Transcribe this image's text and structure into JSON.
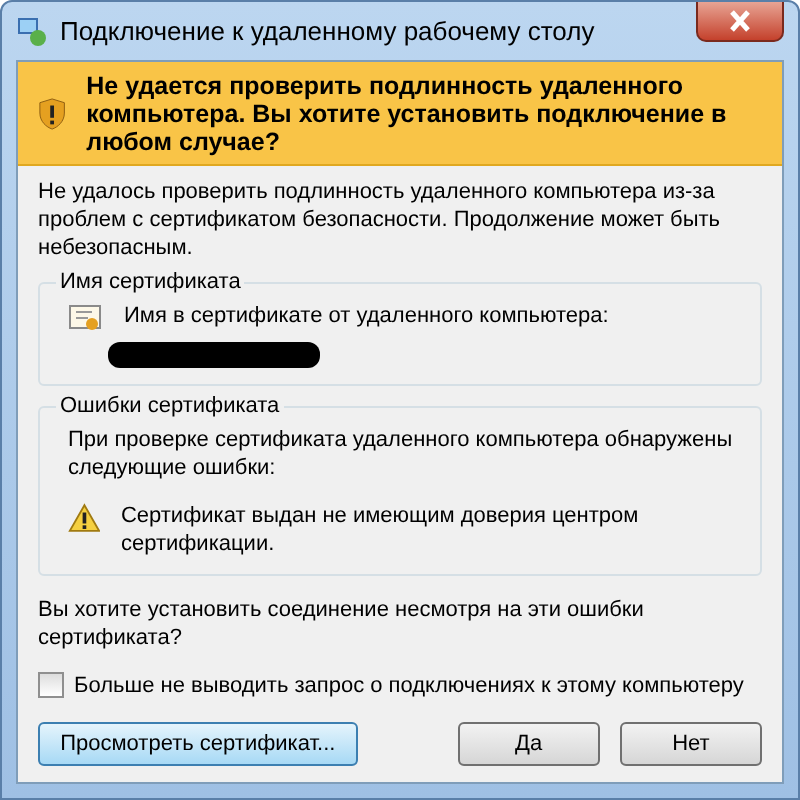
{
  "window": {
    "title": "Подключение к удаленному рабочему столу"
  },
  "banner": {
    "text": "Не удается проверить подлинность удаленного компьютера. Вы хотите установить подключение в любом случае?"
  },
  "description": "Не удалось проверить подлинность удаленного компьютера из-за проблем с сертификатом безопасности. Продолжение может быть небезопасным.",
  "certificate_name": {
    "title": "Имя сертификата",
    "label": "Имя в сертификате от удаленного компьютера:"
  },
  "certificate_errors": {
    "title": "Ошибки сертификата",
    "text": "При проверке сертификата удаленного компьютера обнаружены следующие ошибки:",
    "errors": [
      "Сертификат выдан не имеющим доверия центром сертификации."
    ]
  },
  "question": "Вы хотите установить соединение несмотря на эти ошибки сертификата?",
  "checkbox": {
    "label": "Больше не выводить запрос о подключениях к этому компьютеру",
    "checked": false
  },
  "buttons": [
    {
      "label": "Просмотреть сертификат...",
      "focused": true
    },
    {
      "label": "Да",
      "focused": false
    },
    {
      "label": "Нет",
      "focused": false
    }
  ]
}
